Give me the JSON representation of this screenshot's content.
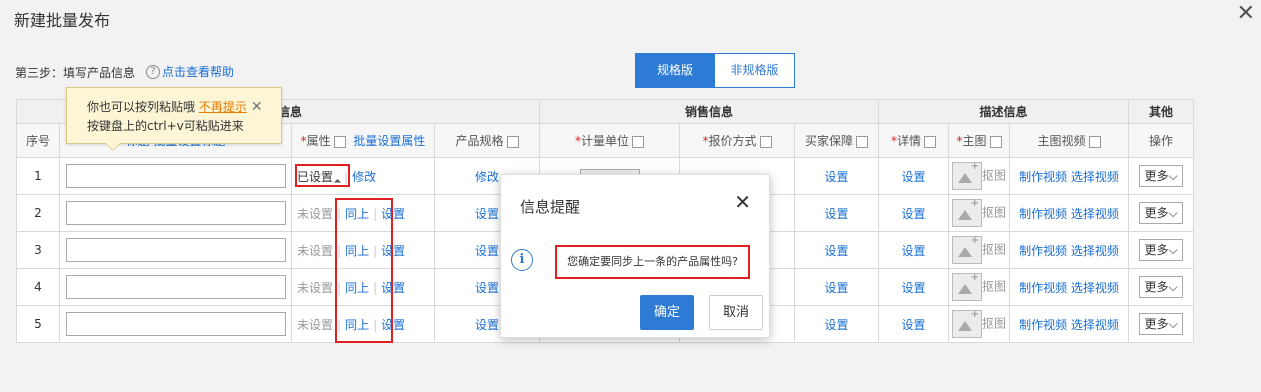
{
  "title": "新建批量发布",
  "close_icon": "close-icon",
  "step_label": "第三步：填写产品信息",
  "help_link": "点击查看帮助",
  "tabs": [
    {
      "label": "规格版",
      "active": true
    },
    {
      "label": "非规格版",
      "active": false
    }
  ],
  "groups": {
    "basic": "基本信息",
    "sales": "销售信息",
    "desc": "描述信息",
    "other": "其他"
  },
  "columns": {
    "seq": "序号",
    "name": "标题 批量设置标题",
    "attr": "属性",
    "attr_batch": "批量设置属性",
    "spec": "产品规格",
    "unit": "计量单位",
    "price": "报价方式",
    "guarantee": "买家保障",
    "detail": "详情",
    "main_img": "主图",
    "main_video": "主图视频",
    "op": "操作"
  },
  "rows": [
    {
      "seq": "1",
      "attr": "已设置",
      "action1": "",
      "action2": "修改",
      "spec": "修改",
      "guarantee": "设置",
      "detail": "设置",
      "cutout": "抠图",
      "make_video": "制作视频",
      "choose_video": "选择视频",
      "more": "更多"
    },
    {
      "seq": "2",
      "attr": "未设置",
      "action1": "同上",
      "action2": "设置",
      "spec": "设置",
      "guarantee": "设置",
      "detail": "设置",
      "cutout": "抠图",
      "make_video": "制作视频",
      "choose_video": "选择视频",
      "more": "更多"
    },
    {
      "seq": "3",
      "attr": "未设置",
      "action1": "同上",
      "action2": "设置",
      "spec": "设置",
      "guarantee": "设置",
      "detail": "设置",
      "cutout": "抠图",
      "make_video": "制作视频",
      "choose_video": "选择视频",
      "more": "更多"
    },
    {
      "seq": "4",
      "attr": "未设置",
      "action1": "同上",
      "action2": "设置",
      "spec": "设置",
      "guarantee": "设置",
      "detail": "设置",
      "cutout": "抠图",
      "make_video": "制作视频",
      "choose_video": "选择视频",
      "more": "更多"
    },
    {
      "seq": "5",
      "attr": "未设置",
      "action1": "同上",
      "action2": "设置",
      "spec": "设置",
      "guarantee": "设置",
      "detail": "设置",
      "cutout": "抠图",
      "make_video": "制作视频",
      "choose_video": "选择视频",
      "more": "更多"
    }
  ],
  "tooltip": {
    "line1": "你也可以按列粘贴哦",
    "link": "不再提示",
    "line2": "按键盘上的ctrl+v可粘贴进来"
  },
  "dialog": {
    "title": "信息提醒",
    "message": "您确定要同步上一条的产品属性吗?",
    "ok": "确定",
    "cancel": "取消"
  },
  "colors": {
    "accent": "#2e7bd6",
    "highlight": "#e02020",
    "link": "#1a6fd4"
  }
}
